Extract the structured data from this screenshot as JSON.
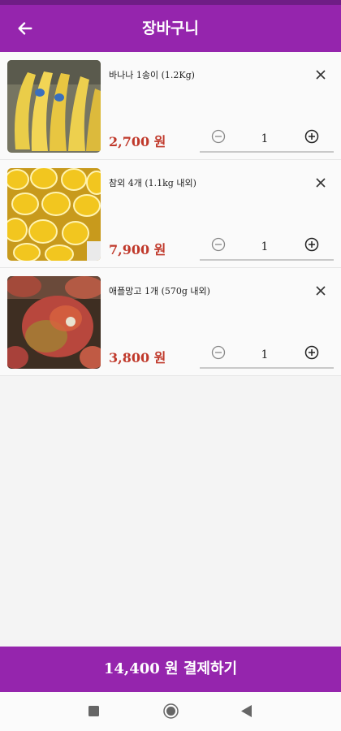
{
  "header": {
    "title": "장바구니"
  },
  "cart": {
    "items": [
      {
        "name": "바나나 1송이 (1.2Kg)",
        "price": "2,700 원",
        "quantity": "1"
      },
      {
        "name": "참외 4개 (1.1kg 내외)",
        "price": "7,900 원",
        "quantity": "1"
      },
      {
        "name": "애플망고 1개 (570g 내외)",
        "price": "3,800 원",
        "quantity": "1"
      }
    ]
  },
  "checkout": {
    "label": "14,400 원 결제하기"
  },
  "colors": {
    "brand": "#9525ad",
    "price": "#c0392b"
  }
}
